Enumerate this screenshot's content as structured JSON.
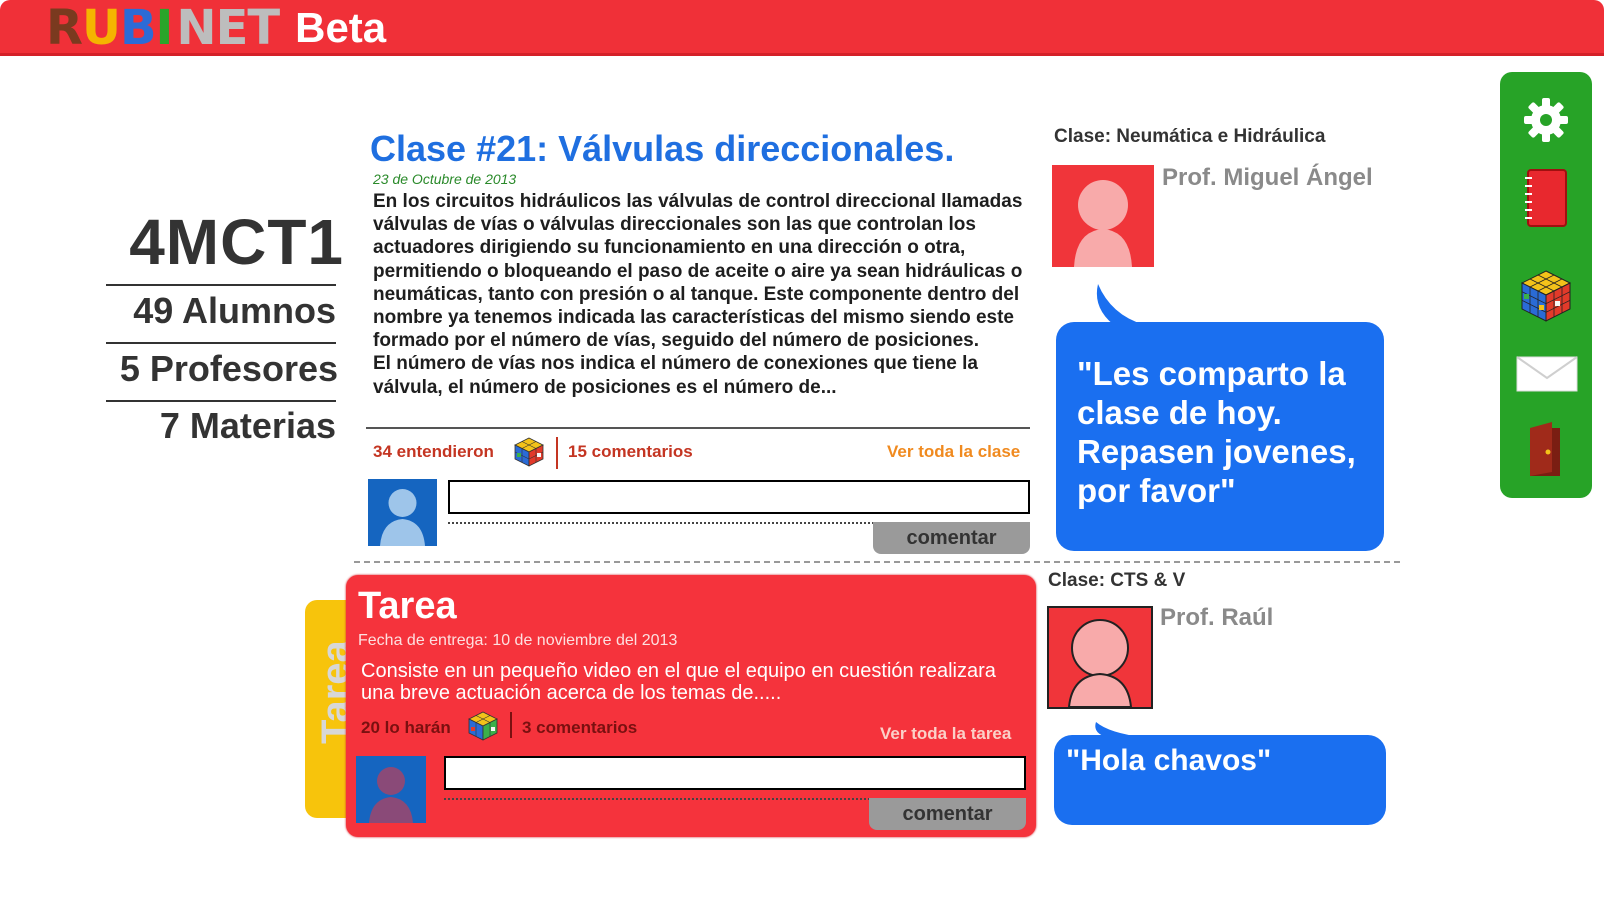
{
  "header": {
    "logo": {
      "r": "R",
      "u": "U",
      "b": "B",
      "i": "I",
      "net": "NET"
    },
    "beta": "Beta"
  },
  "group": {
    "name": "4MCT1",
    "students": "49 Alumnos",
    "teachers": "5 Profesores",
    "subjects": "7 Materias"
  },
  "post": {
    "title": "Clase #21: Válvulas direccionales.",
    "date": "23 de Octubre de 2013",
    "body": "En los circuitos hidráulicos las válvulas de control direccional llamadas válvulas de vías o válvulas direccionales son las que controlan los actuadores dirigiendo su funcionamiento en una dirección o otra, permitiendo o bloqueando el paso de aceite o aire ya sean hidráulicas o neumáticas, tanto con presión o al tanque. Este componente dentro del nombre ya tenemos indicada las características del mismo siendo este formado por el número de vías, seguido del número de posiciones.\nEl número de vías nos indica el número de conexiones que tiene la válvula, el número de posiciones es el número de...",
    "understood": "34 entendieron",
    "comments": "15 comentarios",
    "see_all": "Ver toda la clase",
    "comment_button": "comentar"
  },
  "teacher1": {
    "class_label": "Clase: Neumática e Hidráulica",
    "name": "Prof. Miguel Ángel",
    "quote": "\"Les comparto la clase de hoy. Repasen jovenes, por favor\""
  },
  "teacher2": {
    "class_label": "Clase: CTS & V",
    "name": "Prof. Raúl",
    "quote": "\"Hola chavos\""
  },
  "homework": {
    "tab_label": "Tarea",
    "title": "Tarea",
    "due_date": "Fecha de entrega: 10 de noviembre del 2013",
    "body": "Consiste en un pequeño video en el que el equipo en cuestión realizara una breve actuación acerca de los temas de.....",
    "will_do": "20 lo harán",
    "comments": "3 comentarios",
    "see_all": "Ver toda la tarea",
    "comment_button": "comentar"
  },
  "toolbar": {
    "icons": [
      "gear-icon",
      "notebook-icon",
      "rubik-cube-icon",
      "envelope-icon",
      "door-icon"
    ]
  },
  "colors": {
    "header_red": "#f03038",
    "title_blue": "#1f6fe0",
    "bubble_blue": "#1a6ff0",
    "toolbar_green": "#27a327",
    "homework_red": "#f5333c",
    "homework_tab_yellow": "#f7c40c"
  }
}
